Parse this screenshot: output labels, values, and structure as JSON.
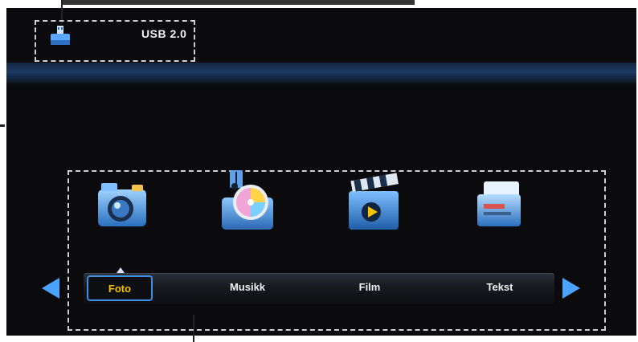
{
  "device": {
    "usb_label": "USB 2.0",
    "usb_icon": "usb-drive-icon"
  },
  "menu": {
    "items": [
      {
        "label": "Foto",
        "icon": "camera-icon",
        "selected": true
      },
      {
        "label": "Musikk",
        "icon": "music-disc-icon",
        "selected": false
      },
      {
        "label": "Film",
        "icon": "film-clapper-icon",
        "selected": false
      },
      {
        "label": "Tekst",
        "icon": "text-document-icon",
        "selected": false
      }
    ],
    "prev_icon": "arrow-left-icon",
    "next_icon": "arrow-right-icon"
  },
  "colors": {
    "background": "#0b0b0d",
    "accent_blue": "#4aa3ff",
    "selected_text": "#f5c200",
    "label_text": "#f1f1f1"
  }
}
